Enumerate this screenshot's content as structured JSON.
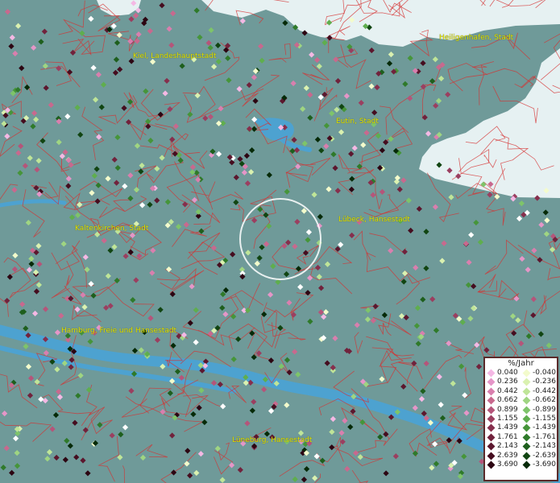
{
  "map": {
    "cities": [
      {
        "name": "Kiel, Landeshauptstadt"
      },
      {
        "name": "Heiligenhafen, Stadt"
      },
      {
        "name": "Eutin, Stadt"
      },
      {
        "name": "Lübeck, Hansestadt"
      },
      {
        "name": "Kaltenkirchen, Stadt"
      },
      {
        "name": "Hamburg, Freie und Hansestadt"
      },
      {
        "name": "Lüneburg, Hansestadt"
      }
    ],
    "colors": {
      "land": "#6f9a99",
      "water": "#e6f1f2",
      "river": "#4da2d0",
      "boundary": "#d63030",
      "label": "#e2e200"
    }
  },
  "legend": {
    "title": "%/Jahr",
    "positive": [
      {
        "label": "0.040",
        "color": "#f4b8e4"
      },
      {
        "label": "0.236",
        "color": "#e596c8"
      },
      {
        "label": "0.442",
        "color": "#d97fae"
      },
      {
        "label": "0.662",
        "color": "#c8698e"
      },
      {
        "label": "0.899",
        "color": "#b5557a"
      },
      {
        "label": "1.155",
        "color": "#9b3f60"
      },
      {
        "label": "1.439",
        "color": "#862f4d"
      },
      {
        "label": "1.761",
        "color": "#71223c"
      },
      {
        "label": "2.143",
        "color": "#5c172e"
      },
      {
        "label": "2.639",
        "color": "#450d1f"
      },
      {
        "label": "3.690",
        "color": "#2c0512"
      }
    ],
    "negative": [
      {
        "label": "-0.040",
        "color": "#f3fbcc"
      },
      {
        "label": "-0.236",
        "color": "#daf1b0"
      },
      {
        "label": "-0.442",
        "color": "#bfe598"
      },
      {
        "label": "-0.662",
        "color": "#9fd582"
      },
      {
        "label": "-0.899",
        "color": "#7ec46a"
      },
      {
        "label": "-1.155",
        "color": "#5fae4e"
      },
      {
        "label": "-1.439",
        "color": "#46953a"
      },
      {
        "label": "-1.761",
        "color": "#2f7a2a"
      },
      {
        "label": "-2.143",
        "color": "#1e5f1d"
      },
      {
        "label": "-2.639",
        "color": "#114512"
      },
      {
        "label": "-3.690",
        "color": "#062a08"
      }
    ]
  }
}
